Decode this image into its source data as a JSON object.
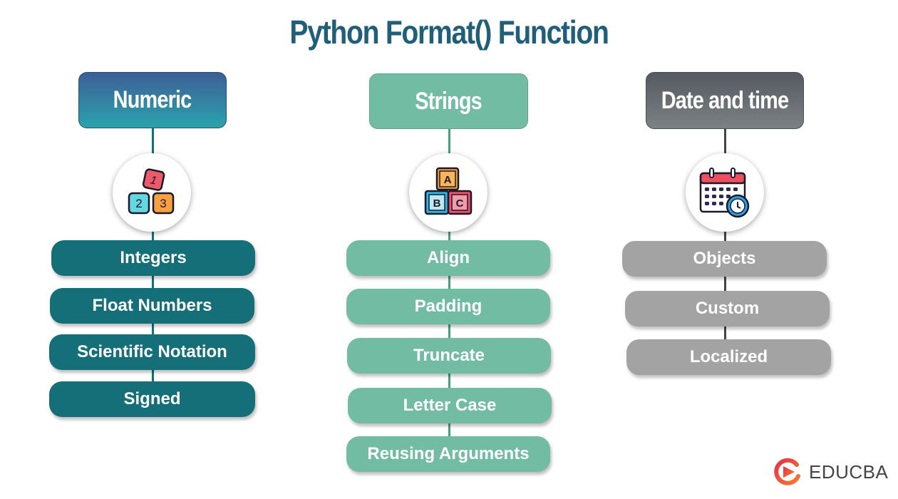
{
  "title": "Python Format() Function",
  "columns": [
    {
      "header": "Numeric",
      "icon": "number-blocks-icon",
      "icon_glyphs": [
        "1",
        "2",
        "3"
      ],
      "items": [
        "Integers",
        "Float Numbers",
        "Scientific Notation",
        "Signed"
      ],
      "colors": {
        "header_top": "#3d5f97",
        "header_bottom": "#2aa3ad",
        "pill": "#146f78",
        "line": "#146f78"
      }
    },
    {
      "header": "Strings",
      "icon": "abc-blocks-icon",
      "icon_glyphs": [
        "A",
        "B",
        "C"
      ],
      "items": [
        "Align",
        "Padding",
        "Truncate",
        "Letter Case",
        "Reusing Arguments"
      ],
      "colors": {
        "header_top": "#72bca3",
        "header_bottom": "#72bca3",
        "pill": "#72bca3",
        "line": "#4c9a84"
      }
    },
    {
      "header": "Date and time",
      "icon": "calendar-clock-icon",
      "icon_glyphs": [],
      "items": [
        "Objects",
        "Custom",
        "Localized"
      ],
      "colors": {
        "header_top": "#555a60",
        "header_bottom": "#7c8186",
        "pill": "#a3a3a3",
        "line": "#444444"
      }
    }
  ],
  "logo": {
    "text": "EDUCBA",
    "color": "#e63c2f"
  }
}
